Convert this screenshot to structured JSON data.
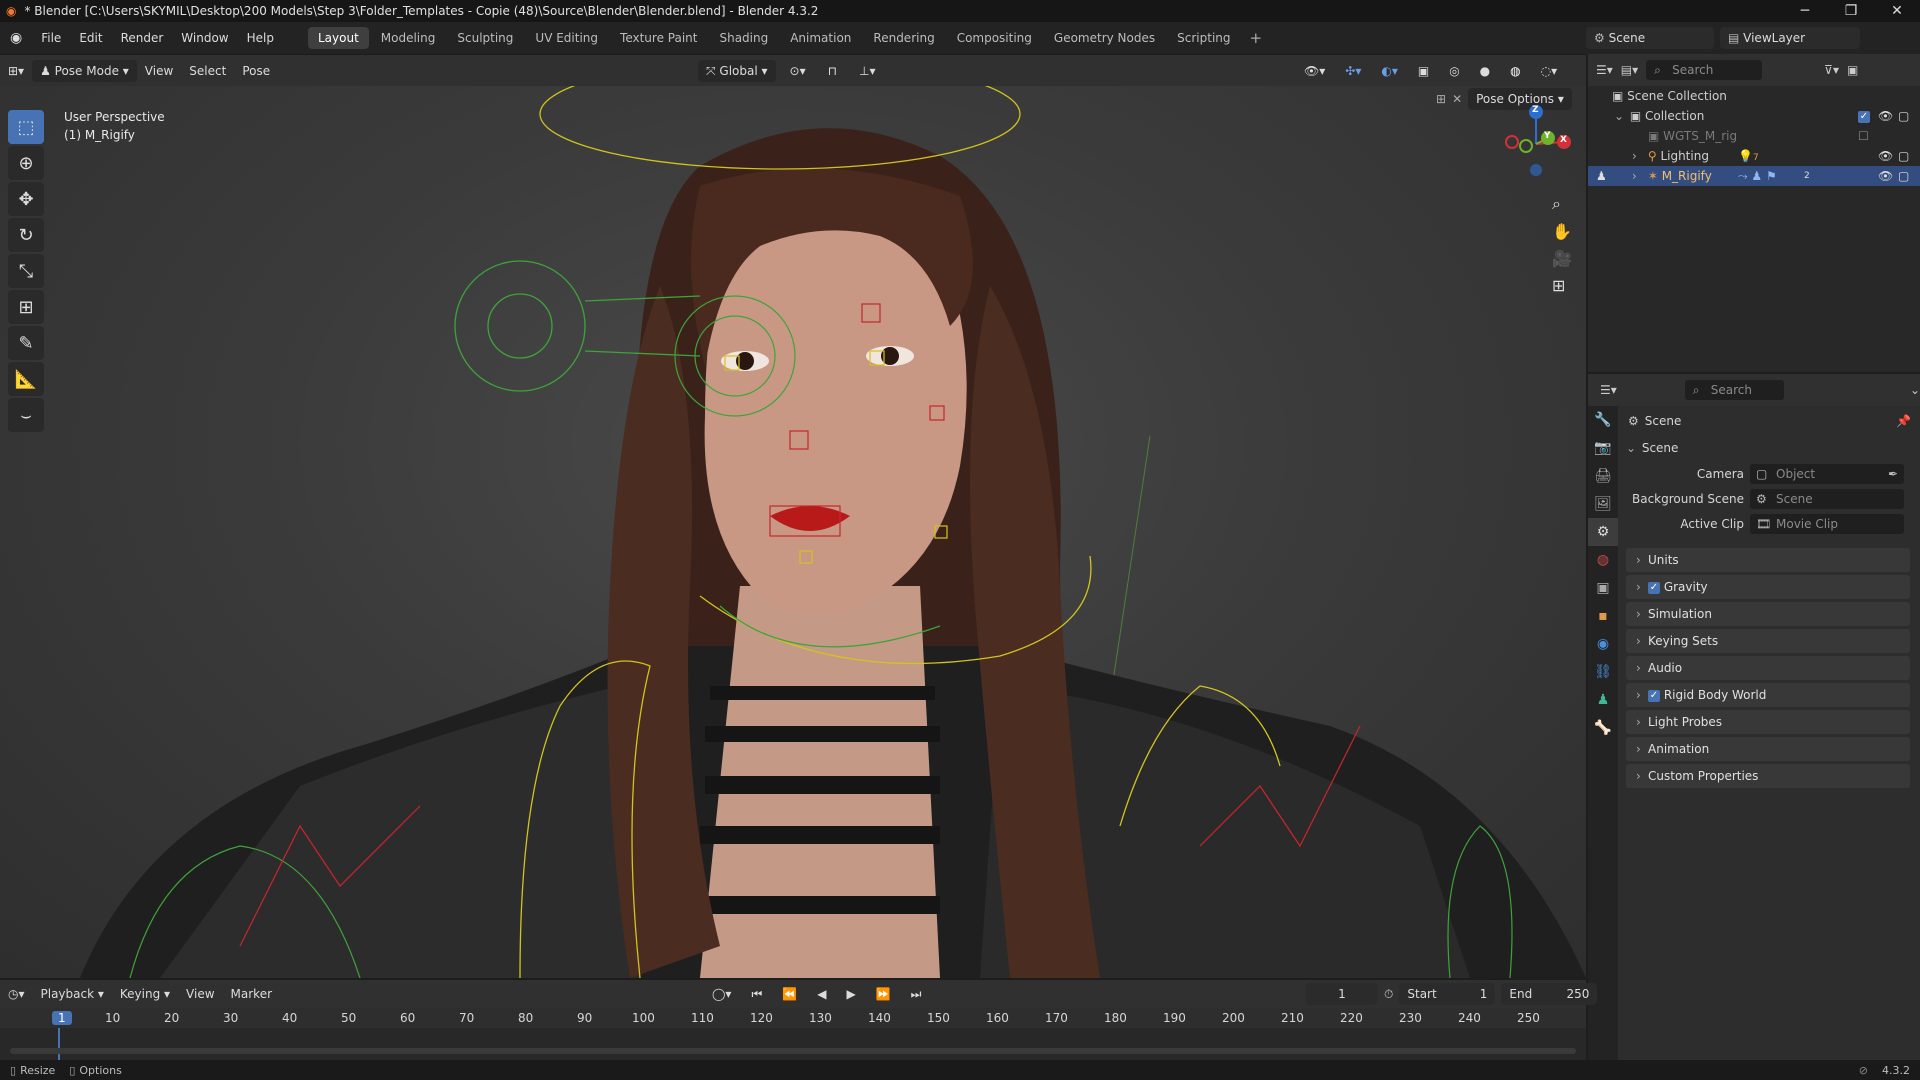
{
  "title": "* Blender [C:\\Users\\SKYMIL\\Desktop\\200 Models\\Step 3\\Folder_Templates - Copie (48)\\Source\\Blender\\Blender.blend] - Blender 4.3.2",
  "menu": [
    "File",
    "Edit",
    "Render",
    "Window",
    "Help"
  ],
  "workspaces": [
    "Layout",
    "Modeling",
    "Sculpting",
    "UV Editing",
    "Texture Paint",
    "Shading",
    "Animation",
    "Rendering",
    "Compositing",
    "Geometry Nodes",
    "Scripting"
  ],
  "active_workspace": "Layout",
  "scene_name": "Scene",
  "view_layer": "ViewLayer",
  "viewport_header": {
    "mode": "Pose Mode",
    "menus": [
      "View",
      "Select",
      "Pose"
    ],
    "orientation": "Global",
    "pose_options": "Pose Options"
  },
  "viewport_overlay": {
    "line1": "User Perspective",
    "line2": "(1) M_Rigify"
  },
  "gizmo": {
    "z": "Z",
    "y": "Y",
    "x": "X"
  },
  "outliner": {
    "search_placeholder": "Search",
    "rows": [
      {
        "label": "Scene Collection"
      },
      {
        "label": "Collection"
      },
      {
        "label": "WGTS_M_rig"
      },
      {
        "label": "Lighting",
        "badge": "7"
      },
      {
        "label": "M_Rigify",
        "badge": "2"
      }
    ]
  },
  "properties": {
    "search_placeholder": "Search",
    "breadcrumb": "Scene",
    "section": "Scene",
    "fields": [
      {
        "label": "Camera",
        "placeholder": "Object"
      },
      {
        "label": "Background Scene",
        "placeholder": "Scene"
      },
      {
        "label": "Active Clip",
        "placeholder": "Movie Clip"
      }
    ],
    "panels": [
      {
        "label": "Units",
        "checkbox": false
      },
      {
        "label": "Gravity",
        "checkbox": true
      },
      {
        "label": "Simulation",
        "checkbox": false
      },
      {
        "label": "Keying Sets",
        "checkbox": false
      },
      {
        "label": "Audio",
        "checkbox": false
      },
      {
        "label": "Rigid Body World",
        "checkbox": true
      },
      {
        "label": "Light Probes",
        "checkbox": false
      },
      {
        "label": "Animation",
        "checkbox": false
      },
      {
        "label": "Custom Properties",
        "checkbox": false
      }
    ]
  },
  "timeline": {
    "menus": [
      "Playback",
      "Keying",
      "View",
      "Marker"
    ],
    "current_frame": "1",
    "start_label": "Start",
    "start": "1",
    "end_label": "End",
    "end": "250",
    "ticks": [
      "1",
      "10",
      "20",
      "30",
      "40",
      "50",
      "60",
      "70",
      "80",
      "90",
      "100",
      "110",
      "120",
      "130",
      "140",
      "150",
      "160",
      "170",
      "180",
      "190",
      "200",
      "210",
      "220",
      "230",
      "240",
      "250"
    ]
  },
  "status": {
    "left1": "Resize",
    "left2": "Options",
    "version": "4.3.2"
  },
  "colors": {
    "accent": "#4772b3",
    "rig_yellow": "#d2c41e",
    "rig_green": "#3fa33a",
    "rig_red": "#c8262b"
  }
}
